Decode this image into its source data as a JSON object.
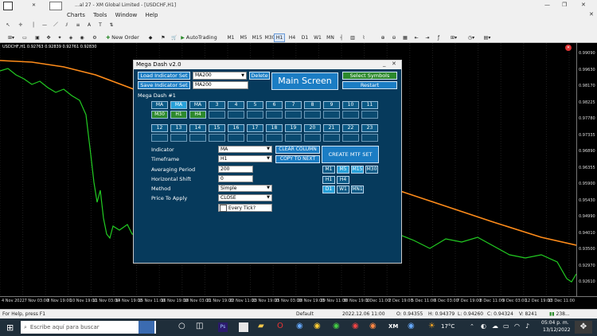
{
  "window": {
    "title": "...al 27 - XM Global Limited - [USDCHF,H1]"
  },
  "menu": [
    "Charts",
    "Tools",
    "Window",
    "Help"
  ],
  "toolbar": {
    "new_order": "New Order",
    "autotrading": "AutoTrading"
  },
  "timeframes": [
    "M1",
    "M5",
    "M15",
    "M30",
    "H1",
    "H4",
    "D1",
    "W1",
    "MN"
  ],
  "active_timeframe": "H1",
  "chart": {
    "symbol_line": "USDCHF,H1  0.92763 0.92839 0.92761 0.92830",
    "price_labels": [
      "0.99090",
      "0.99630",
      "0.98170",
      "0.98225",
      "0.97780",
      "0.97335",
      "0.96890",
      "0.96355",
      "0.95900",
      "0.95430",
      "0.94990",
      "0.94010",
      "0.93500",
      "0.92970",
      "0.92610"
    ],
    "time_labels": [
      "4 Nov 2022",
      "7 Nov 03:00",
      "8 Nov 19:00",
      "10 Nov 19:00",
      "11 Nov 03:00",
      "14 Nov 19:00",
      "15 Nov 11:00",
      "16 Nov 19:00",
      "18 Nov 03:00",
      "21 Nov 19:00",
      "22 Nov 11:00",
      "23 Nov 19:00",
      "25 Nov 03:00",
      "28 Nov 19:00",
      "29 Nov 11:00",
      "30 Nov 19:00",
      "1 Dec 11:00",
      "2 Dec 19:00",
      "5 Dec 11:00",
      "6 Dec 03:00",
      "7 Dec 19:00",
      "8 Dec 11:00",
      "9 Dec 03:00",
      "12 Dec 19:00",
      "13 Dec 11:00"
    ]
  },
  "dash": {
    "title": "Mega Dash v2.0",
    "load_indicator_set": "Load Indicator Set",
    "save_indicator_set": "Save Indicator Set",
    "load_value": "MA200",
    "save_value": "MA200",
    "delete": "Delete",
    "main_screen": "Main Screen",
    "select_symbols": "Select Symbols",
    "restart": "Restart",
    "section_title": "Mega Dash #1",
    "row1": [
      "MA",
      "MA",
      "MA",
      "3",
      "4",
      "5",
      "6",
      "7",
      "8",
      "9",
      "10",
      "11"
    ],
    "row2": [
      "M30",
      "H1",
      "H4",
      "",
      "",
      "",
      "",
      "",
      "",
      "",
      "",
      ""
    ],
    "row3": [
      "12",
      "13",
      "14",
      "15",
      "16",
      "17",
      "18",
      "19",
      "20",
      "21",
      "22",
      "23"
    ],
    "indicator_label": "Indicator",
    "indicator_value": "MA",
    "timeframe_label": "Timeframe",
    "timeframe_value": "H1",
    "averaging_label": "Averaging Period",
    "averaging_value": "200",
    "shift_label": "Horizontal Shift",
    "shift_value": "0",
    "method_label": "Method",
    "method_value": "Simple",
    "price_label": "Price To Apply",
    "price_value": "CLOSE",
    "every_tick": "Every Tick?",
    "clear_column": "CLEAR COLUMN",
    "copy_to_next": "COPY TO NEXT",
    "create_mtf": "CREATE MTF SET",
    "mtf_buttons": [
      "M1",
      "M5",
      "M15",
      "M30",
      "H1",
      "H4",
      "D1",
      "W1",
      "MN1"
    ],
    "mtf_active": [
      "M5",
      "M15",
      "D1"
    ]
  },
  "status": {
    "help": "For Help, press F1",
    "profile": "Default",
    "datetime": "2022.12.06 11:00",
    "open": "O: 0.94355",
    "high": "H: 0.94379",
    "low": "L: 0.94260",
    "close": "C: 0.94324",
    "volume": "V: 8241",
    "traffic": "238..."
  },
  "taskbar": {
    "search_placeholder": "Escribe aquí para buscar",
    "temperature": "17°C",
    "time": "05:04 p. m.",
    "date": "13/12/2022"
  },
  "colors": {
    "ma_line": "#ff8c1a",
    "candles": "#22cc22",
    "dash_bg": "#063a5c",
    "button": "#1b7dc4",
    "active_cell": "#27a0d8",
    "green_cell": "#2d8a2d"
  }
}
